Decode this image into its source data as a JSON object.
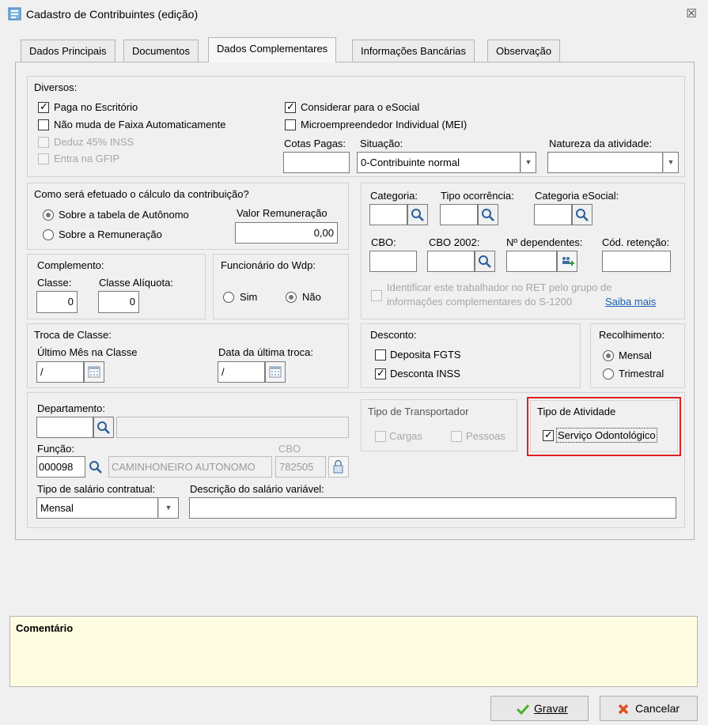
{
  "window": {
    "title": "Cadastro de Contribuintes (edição)",
    "close_glyph": "☒"
  },
  "tabs": [
    {
      "label": "Dados Principais"
    },
    {
      "label": "Documentos"
    },
    {
      "label": "Dados Complementares"
    },
    {
      "label": "Informações Bancárias"
    },
    {
      "label": "Observação"
    }
  ],
  "active_tab": "Dados Complementares",
  "diversos": {
    "title": "Diversos:",
    "paga_escritorio": "Paga no Escritório",
    "nao_muda_faixa": "Não muda de Faixa Automaticamente",
    "deduz_inss": "Deduz 45% INSS",
    "entra_gfip": "Entra na GFIP",
    "considerar_esocial": "Considerar para o eSocial",
    "mei": "Microempreendedor Individual (MEI)",
    "cotas_label": "Cotas Pagas:",
    "cotas_value": "",
    "situacao_label": "Situação:",
    "situacao_value": "0-Contribuinte normal",
    "natureza_label": "Natureza da atividade:",
    "natureza_value": ""
  },
  "calculo": {
    "title": "Como será efetuado o cálculo da contribuição?",
    "opt_tabela": "Sobre a tabela de Autônomo",
    "opt_remuneracao": "Sobre a Remuneração",
    "valor_label": "Valor Remuneração",
    "valor_value": "0,00"
  },
  "complemento": {
    "title": "Complemento:",
    "classe_label": "Classe:",
    "classe_value": "0",
    "aliquota_label": "Classe Alíquota:",
    "aliquota_value": "0"
  },
  "funcionario": {
    "title": "Funcionário do Wdp:",
    "sim": "Sim",
    "nao": "Não"
  },
  "categoria": {
    "categoria_label": "Categoria:",
    "tipo_ocorrencia_label": "Tipo ocorrência:",
    "categoria_esocial_label": "Categoria eSocial:",
    "cbo_label": "CBO:",
    "cbo2002_label": "CBO 2002:",
    "dependentes_label": "Nº dependentes:",
    "retencao_label": "Cód. retenção:",
    "ret_line1": "Identificar este trabalhador no RET pelo grupo de",
    "ret_line2": "informações complementares do S-1200",
    "saiba_mais": "Saiba mais"
  },
  "troca": {
    "title": "Troca de Classe:",
    "ultimo_label": "Último Mês na Classe",
    "ultimo_value": "/",
    "data_label": "Data da última troca:",
    "data_value": "/"
  },
  "desconto": {
    "title": "Desconto:",
    "fgts": "Deposita FGTS",
    "inss": "Desconta INSS"
  },
  "recolhimento": {
    "title": "Recolhimento:",
    "mensal": "Mensal",
    "trimestral": "Trimestral"
  },
  "departamento": {
    "dep_label": "Departamento:",
    "dep_value": "",
    "dep_desc": "",
    "funcao_label": "Função:",
    "funcao_code": "000098",
    "funcao_desc": "CAMINHONEIRO AUTONOMO",
    "cbo_label": "CBO",
    "cbo_value": "782505",
    "salario_label": "Tipo de salário contratual:",
    "salario_value": "Mensal",
    "desc_variavel_label": "Descrição do salário variável:",
    "desc_variavel_value": ""
  },
  "transportador": {
    "title": "Tipo de Transportador",
    "cargas": "Cargas",
    "pessoas": "Pessoas"
  },
  "atividade": {
    "title": "Tipo de Atividade",
    "servico": "Serviço Odontológico"
  },
  "comentario": {
    "label": "Comentário"
  },
  "buttons": {
    "gravar": "Gravar",
    "cancelar": "Cancelar"
  },
  "colors": {
    "highlight": "#e02020",
    "comment_bg": "#fffde1",
    "link": "#1a5fb4"
  }
}
